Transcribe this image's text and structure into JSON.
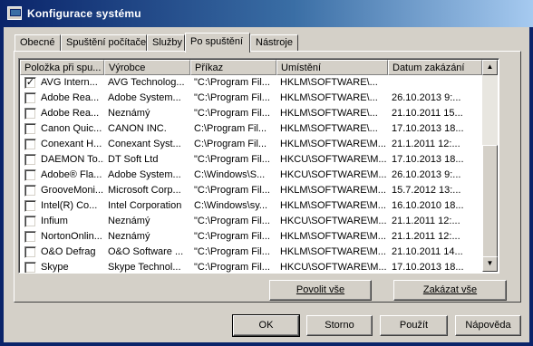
{
  "window": {
    "title": "Konfigurace systému"
  },
  "tabs": [
    {
      "label": "Obecné"
    },
    {
      "label": "Spuštění počítače"
    },
    {
      "label": "Služby"
    },
    {
      "label": "Po spuštění"
    },
    {
      "label": "Nástroje"
    }
  ],
  "active_tab": "Po spuštění",
  "table": {
    "columns": [
      "Položka při spu...",
      "Výrobce",
      "Příkaz",
      "Umístění",
      "Datum zakázání"
    ],
    "rows": [
      {
        "checked": true,
        "cells": [
          "AVG Intern...",
          "AVG Technolog...",
          "\"C:\\Program Fil...",
          "HKLM\\SOFTWARE\\...",
          ""
        ]
      },
      {
        "checked": false,
        "cells": [
          "Adobe Rea...",
          "Adobe System...",
          "\"C:\\Program Fil...",
          "HKLM\\SOFTWARE\\...",
          "26.10.2013 9:..."
        ]
      },
      {
        "checked": false,
        "cells": [
          "Adobe Rea...",
          "Neznámý",
          "\"C:\\Program Fil...",
          "HKLM\\SOFTWARE\\...",
          "21.10.2011 15..."
        ]
      },
      {
        "checked": false,
        "cells": [
          "Canon Quic...",
          "CANON INC.",
          "C:\\Program Fil...",
          "HKLM\\SOFTWARE\\...",
          "17.10.2013 18..."
        ]
      },
      {
        "checked": false,
        "cells": [
          "Conexant H...",
          "Conexant Syst...",
          "C:\\Program Fil...",
          "HKLM\\SOFTWARE\\M...",
          "21.1.2011 12:..."
        ]
      },
      {
        "checked": false,
        "cells": [
          "DAEMON To...",
          "DT Soft Ltd",
          "\"C:\\Program Fil...",
          "HKCU\\SOFTWARE\\M...",
          "17.10.2013 18..."
        ]
      },
      {
        "checked": false,
        "cells": [
          "Adobe® Fla...",
          "Adobe System...",
          "C:\\Windows\\S...",
          "HKCU\\SOFTWARE\\M...",
          "26.10.2013 9:..."
        ]
      },
      {
        "checked": false,
        "cells": [
          "GrooveMoni...",
          "Microsoft Corp...",
          "\"C:\\Program Fil...",
          "HKLM\\SOFTWARE\\M...",
          "15.7.2012 13:..."
        ]
      },
      {
        "checked": false,
        "cells": [
          "Intel(R) Co...",
          "Intel Corporation",
          "C:\\Windows\\sy...",
          "HKLM\\SOFTWARE\\M...",
          "16.10.2010 18..."
        ]
      },
      {
        "checked": false,
        "cells": [
          "Infium",
          "Neznámý",
          "\"C:\\Program Fil...",
          "HKCU\\SOFTWARE\\M...",
          "21.1.2011 12:..."
        ]
      },
      {
        "checked": false,
        "cells": [
          "NortonOnlin...",
          "Neznámý",
          "\"C:\\Program Fil...",
          "HKLM\\SOFTWARE\\M...",
          "21.1.2011 12:..."
        ]
      },
      {
        "checked": false,
        "cells": [
          "O&O Defrag",
          "O&O Software ...",
          "\"C:\\Program Fil...",
          "HKLM\\SOFTWARE\\M...",
          "21.10.2011 14..."
        ]
      },
      {
        "checked": false,
        "cells": [
          "Skype",
          "Skype Technol...",
          "\"C:\\Program Fil...",
          "HKCU\\SOFTWARE\\M...",
          "17.10.2013 18..."
        ]
      }
    ]
  },
  "scrollbar": {
    "up_glyph": "▲",
    "down_glyph": "▼"
  },
  "buttons": {
    "enable_all": "Povolit vše",
    "disable_all": "Zakázat vše",
    "ok": "OK",
    "cancel": "Storno",
    "apply": "Použít",
    "help": "Nápověda"
  },
  "check_glyph": "✓",
  "colors": {
    "face": "#d4d0c8",
    "title_start": "#0a246a",
    "title_end": "#a6caf0"
  }
}
